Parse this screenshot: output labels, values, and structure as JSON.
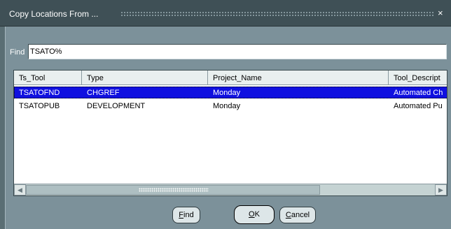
{
  "window": {
    "title": "Copy Locations From ...",
    "close_glyph": "×"
  },
  "find": {
    "label": "Find",
    "value": "TSATO%"
  },
  "grid": {
    "columns": [
      "Ts_Tool",
      "Type",
      "Project_Name",
      "Tool_Descript"
    ],
    "rows": [
      [
        "TSATOFND",
        "CHGREF",
        "Monday",
        "Automated Ch"
      ],
      [
        "TSATOPUB",
        "DEVELOPMENT",
        "Monday",
        "Automated Pu"
      ]
    ],
    "selected_row": 0
  },
  "scrollbar": {
    "left_glyph": "◀",
    "right_glyph": "▶"
  },
  "buttons": {
    "find": {
      "first": "F",
      "rest": "ind"
    },
    "ok": {
      "first": "O",
      "rest": "K"
    },
    "cancel": {
      "first": "C",
      "rest": "ancel"
    }
  },
  "colors": {
    "selection": "#1010e0",
    "titlebar": "#3f5056",
    "dialog": "#7c919a"
  }
}
